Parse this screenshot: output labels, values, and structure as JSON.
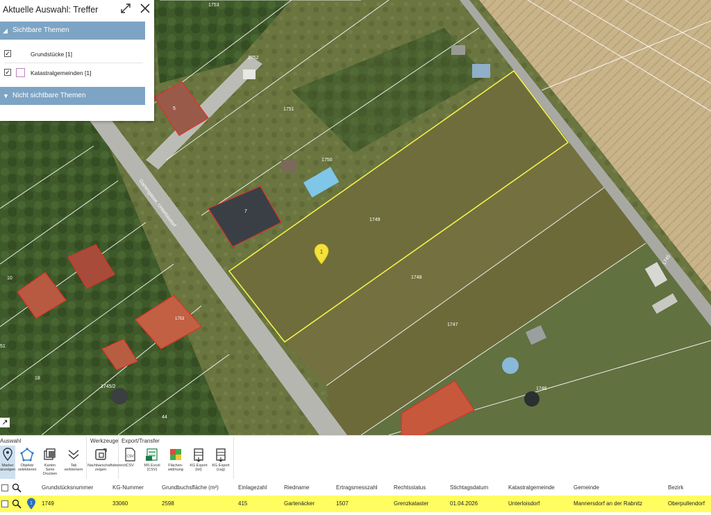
{
  "panel": {
    "title": "Aktuelle Auswahl: Treffer",
    "visible_section": "Sichtbare Themen",
    "hidden_section": "Nicht sichtbare Themen",
    "layers": [
      {
        "label": "Grundstücke [1]",
        "checked": true,
        "swatch": false
      },
      {
        "label": "Katastralgemeinden [1]",
        "checked": true,
        "swatch": true
      }
    ]
  },
  "map": {
    "parcel_labels": [
      "1753",
      "1752",
      "1751",
      "1750",
      "1749",
      "1748",
      "1747",
      "1746",
      "1745/2",
      "1745",
      "44",
      "10",
      "18",
      "51",
      "5",
      "7",
      "1753"
    ],
    "road_label": "Gartengasse, Unterloisdorf",
    "marker_number": "1"
  },
  "toolbar": {
    "groups": [
      "Auswahl",
      "Werkzeuge",
      "Export/Transfer"
    ],
    "tools": [
      {
        "label": "Marker anzeigen",
        "icon": "map-marker-icon",
        "active": true
      },
      {
        "label": "Objekte selektieren",
        "icon": "select-objects-icon",
        "active": false
      },
      {
        "label": "Karten Serie Drucken",
        "icon": "print-series-icon",
        "active": false
      },
      {
        "label": "Tab verkleinern",
        "icon": "collapse-chevron-icon",
        "active": false
      },
      {
        "label": "Nachbarschaftsbereich zeigen",
        "icon": "neighbour-area-icon",
        "active": false
      },
      {
        "label": "CSV",
        "icon": "csv-file-icon",
        "active": false
      },
      {
        "label": "MS Excel (CSV)",
        "icon": "excel-icon",
        "active": false
      },
      {
        "label": "Flächen-widmung",
        "icon": "zoning-icon",
        "active": false
      },
      {
        "label": "KG Export (txt)",
        "icon": "export-txt-icon",
        "active": false
      },
      {
        "label": "KG Export (csg)",
        "icon": "export-csg-icon",
        "active": false
      }
    ]
  },
  "table": {
    "columns": [
      "Grundstücksnummer",
      "KG-Nummer",
      "Grundbuchsfläche (m²)",
      "Einlagezahl",
      "Riedname",
      "Ertragsmesszahl",
      "Rechtsstatus",
      "Stichtagsdatum",
      "Katastralgemeinde",
      "Gemeinde",
      "Bezirk"
    ],
    "rows": [
      {
        "marker": "1",
        "cells": [
          "1749",
          "33060",
          "2598",
          "415",
          "Gartenäcker",
          "1507",
          "Grenzkataster",
          "01.04.2026",
          "Unterloisdorf",
          "Mannersdorf an der Rabnitz",
          "Oberpullendorf"
        ]
      }
    ]
  },
  "colors": {
    "section_header": "#7da4c4",
    "selection_outline": "#f2f24a",
    "row_highlight": "#fffd60",
    "marker": "#f5e13a",
    "building_outline": "#e0302a"
  }
}
